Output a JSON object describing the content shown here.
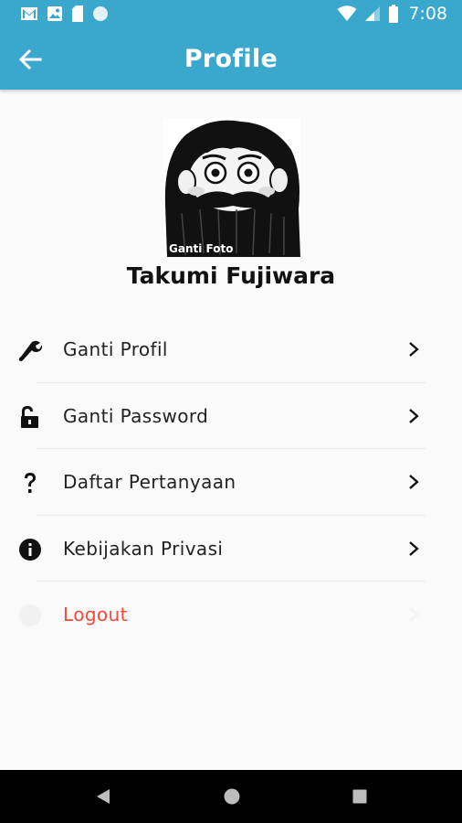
{
  "status_bar": {
    "time": "7:08",
    "left_icons": [
      "gmail-icon",
      "photo-icon",
      "sim-icon",
      "circle-icon"
    ],
    "right_icons": [
      "wifi-icon",
      "signal-icon",
      "battery-icon"
    ]
  },
  "app_bar": {
    "title": "Profile",
    "back_icon": "arrow-left-icon"
  },
  "profile": {
    "change_photo_label": "Ganti Foto",
    "name": "Takumi Fujiwara"
  },
  "menu": [
    {
      "label": "Ganti Profil",
      "icon": "wrench-icon"
    },
    {
      "label": "Ganti Password",
      "icon": "unlock-icon"
    },
    {
      "label": "Daftar Pertanyaan",
      "icon": "question-icon"
    },
    {
      "label": "Kebijakan Privasi",
      "icon": "info-icon"
    },
    {
      "label": "Logout",
      "icon": "logout-icon"
    }
  ],
  "colors": {
    "primary": "#3aa7cc",
    "logout": "#f24a3a",
    "background": "#fafafa"
  },
  "nav_bar": {
    "buttons": [
      "back-triangle-icon",
      "home-circle-icon",
      "recents-square-icon"
    ]
  }
}
